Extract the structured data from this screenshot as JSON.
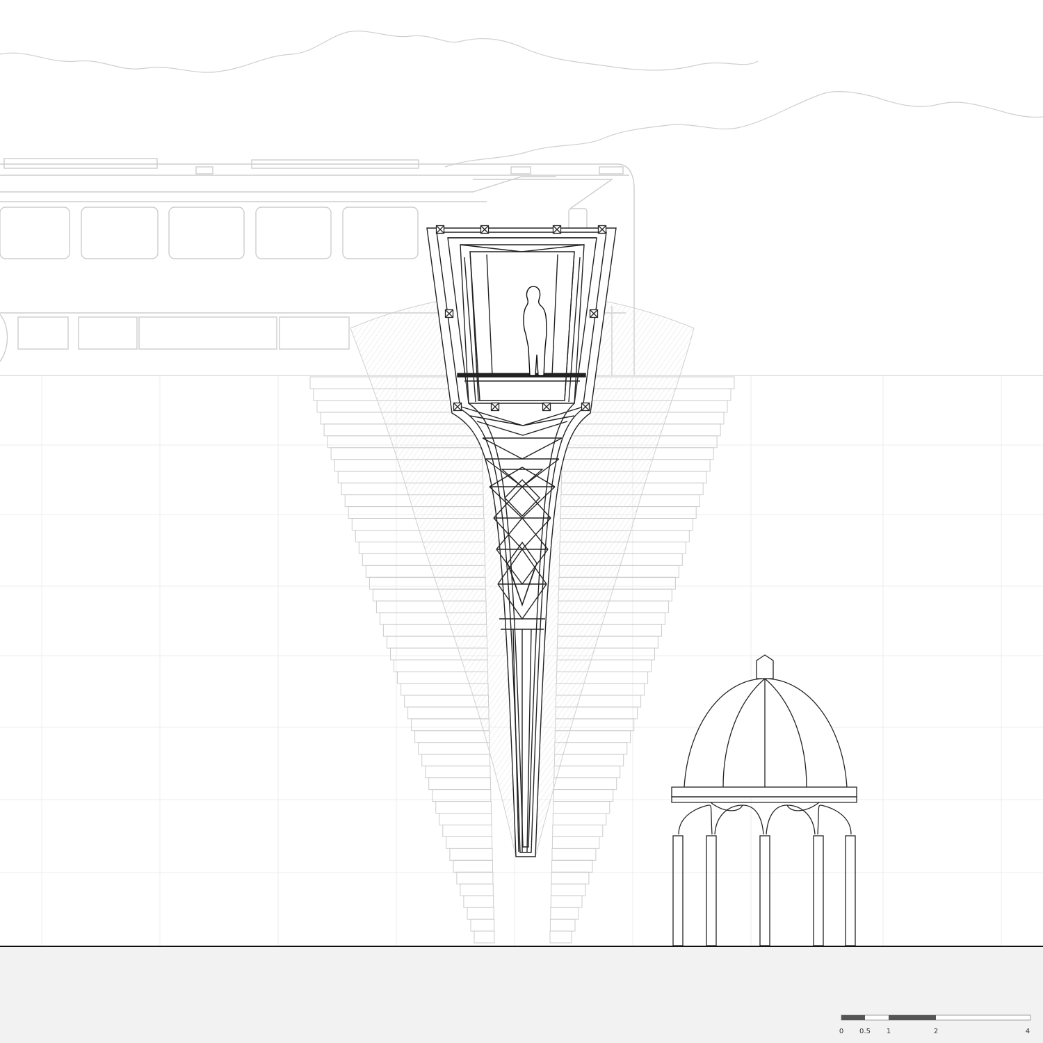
{
  "drawing": {
    "type": "architectural elevation",
    "colors": {
      "line": "#222222",
      "faint_line": "#c8c8c8",
      "ground_fill": "#f2f2f2",
      "background": "#ffffff",
      "scale_dark": "#555555"
    }
  },
  "scale_bar": {
    "labels": [
      "0",
      "0.5",
      "1",
      "2",
      "4"
    ],
    "values": [
      0,
      0.5,
      1,
      2,
      4
    ]
  }
}
